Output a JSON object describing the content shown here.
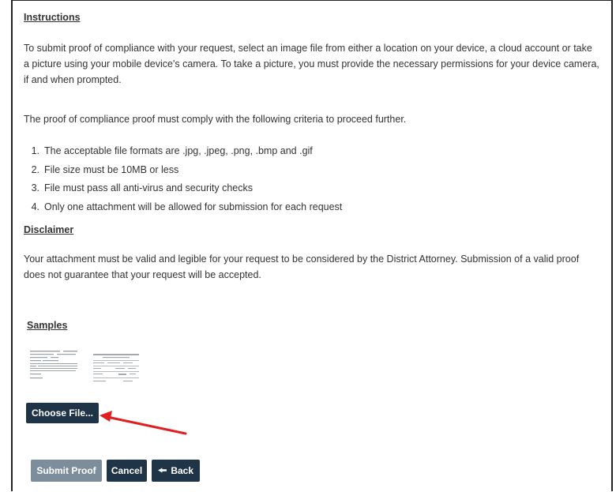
{
  "instructions": {
    "heading": "Instructions",
    "paragraph1": "To submit proof of compliance with your request, select an image file from either a location on your device, a cloud account or take a picture using your mobile device's camera. To take a picture, you must provide the necessary permissions for your device camera, if and when prompted.",
    "paragraph2": "The proof of compliance proof must comply with the following criteria to proceed further.",
    "criteria": [
      {
        "num": "1.",
        "text": "The acceptable file formats are .jpg, .jpeg, .png, .bmp and .gif"
      },
      {
        "num": "2.",
        "text": "File size must be 10MB or less"
      },
      {
        "num": "3.",
        "text": "File must pass all anti-virus and security checks"
      },
      {
        "num": "4.",
        "text": "Only one attachment will be allowed for submission for each request"
      }
    ]
  },
  "disclaimer": {
    "heading": "Disclaimer",
    "text": "Your attachment must be valid and legible for your request to be considered by the District Attorney. Submission of a valid proof does not guarantee that your request will be accepted."
  },
  "samples": {
    "heading": "Samples"
  },
  "buttons": {
    "choose_file": "Choose File...",
    "submit_proof": "Submit Proof",
    "cancel": "Cancel",
    "back": "Back"
  },
  "colors": {
    "button_bg": "#1f3447",
    "button_disabled_bg": "#7c8d9b",
    "annotation_arrow": "#e02020"
  },
  "icons": {
    "back": "arrow-left-icon",
    "annotation": "red-arrow-annotation"
  }
}
